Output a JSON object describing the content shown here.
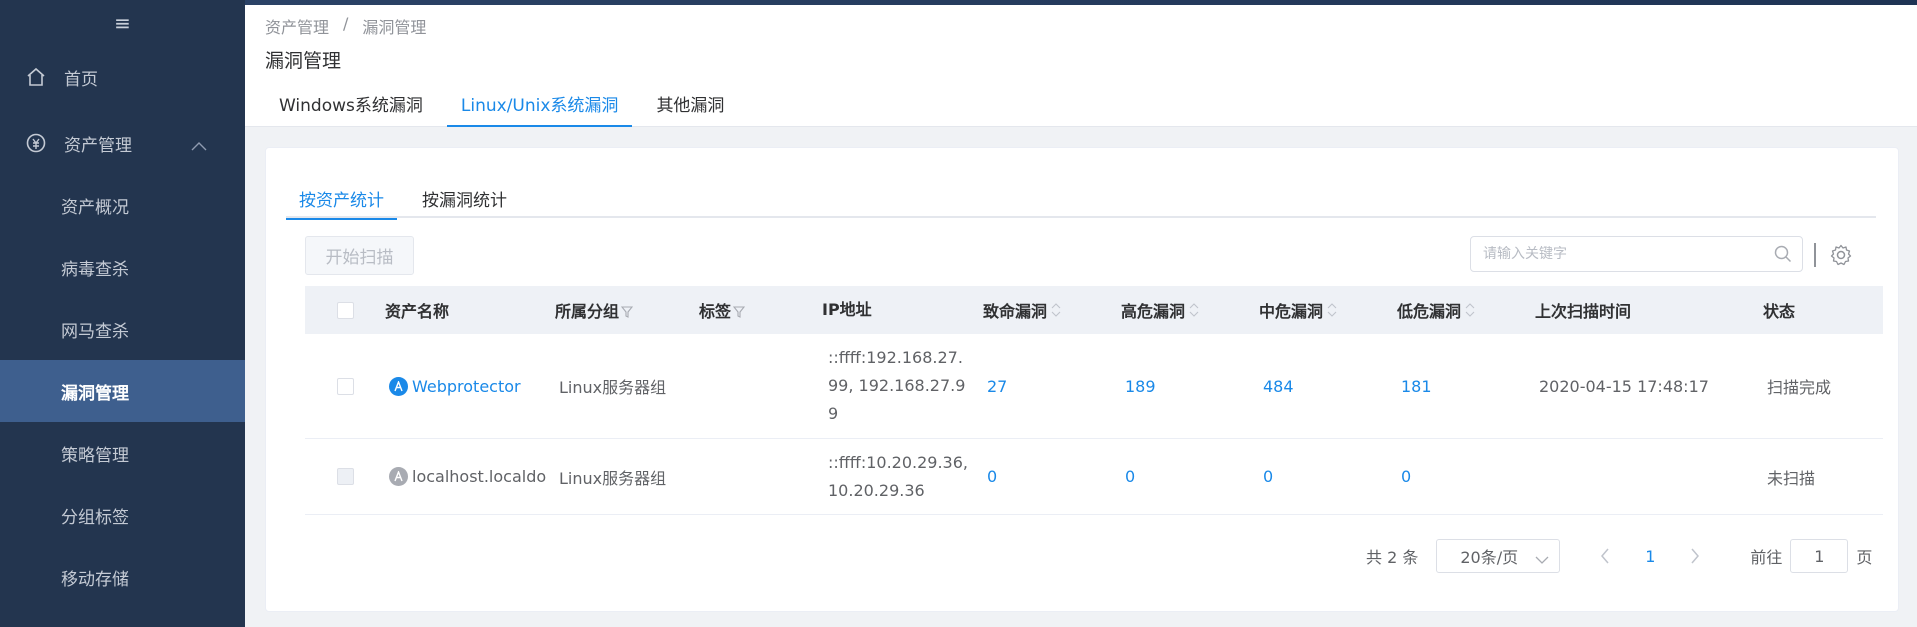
{
  "sidebar": {
    "menu_icon": "≡",
    "items": [
      {
        "label": "首页",
        "icon": "home-icon"
      },
      {
        "label": "资产管理",
        "icon": "asset-icon"
      }
    ],
    "sub_items": [
      "资产概况",
      "病毒查杀",
      "网马查杀",
      "漏洞管理",
      "策略管理",
      "分组标签",
      "移动存储"
    ],
    "active": "漏洞管理"
  },
  "breadcrumb": {
    "parent": "资产管理",
    "separator": "/",
    "current": "漏洞管理"
  },
  "page_title": "漏洞管理",
  "top_tabs": [
    "Windows系统漏洞",
    "Linux/Unix系统漏洞",
    "其他漏洞"
  ],
  "sub_tabs": [
    "按资产统计",
    "按漏洞统计"
  ],
  "toolbar": {
    "scan_label": "开始扫描",
    "search_placeholder": "请输入关键字"
  },
  "table": {
    "headers": {
      "name": "资产名称",
      "group": "所属分组",
      "tag": "标签",
      "ip": "IP地址",
      "critical": "致命漏洞",
      "high": "高危漏洞",
      "medium": "中危漏洞",
      "low": "低危漏洞",
      "last_scan": "上次扫描时间",
      "status": "状态"
    },
    "rows": [
      {
        "name": "Webprotector",
        "group": "Linux服务器组",
        "tag": "",
        "ip": "::ffff:192.168.27.99, 192.168.27.99",
        "ip_lines": [
          "::ffff:192.168.27.",
          "99, 192.168.27.9",
          "9"
        ],
        "critical": "27",
        "high": "189",
        "medium": "484",
        "low": "181",
        "last_scan": "2020-04-15 17:48:17",
        "status": "扫描完成"
      },
      {
        "name": "localhost.localdo",
        "group": "Linux服务器组",
        "tag": "",
        "ip": "::ffff:10.20.29.36, 10.20.29.36",
        "ip_lines": [
          "::ffff:10.20.29.36,",
          "10.20.29.36"
        ],
        "critical": "0",
        "high": "0",
        "medium": "0",
        "low": "0",
        "last_scan": "",
        "status": "未扫描"
      }
    ]
  },
  "pagination": {
    "total": "共 2 条",
    "page_size": "20条/页",
    "current_page": "1",
    "goto_label": "前往",
    "goto_value": "1",
    "page_suffix": "页"
  },
  "colors": {
    "sidebar_bg": "#23354f",
    "active_item": "#3e5f8e",
    "accent": "#1a89e8"
  }
}
